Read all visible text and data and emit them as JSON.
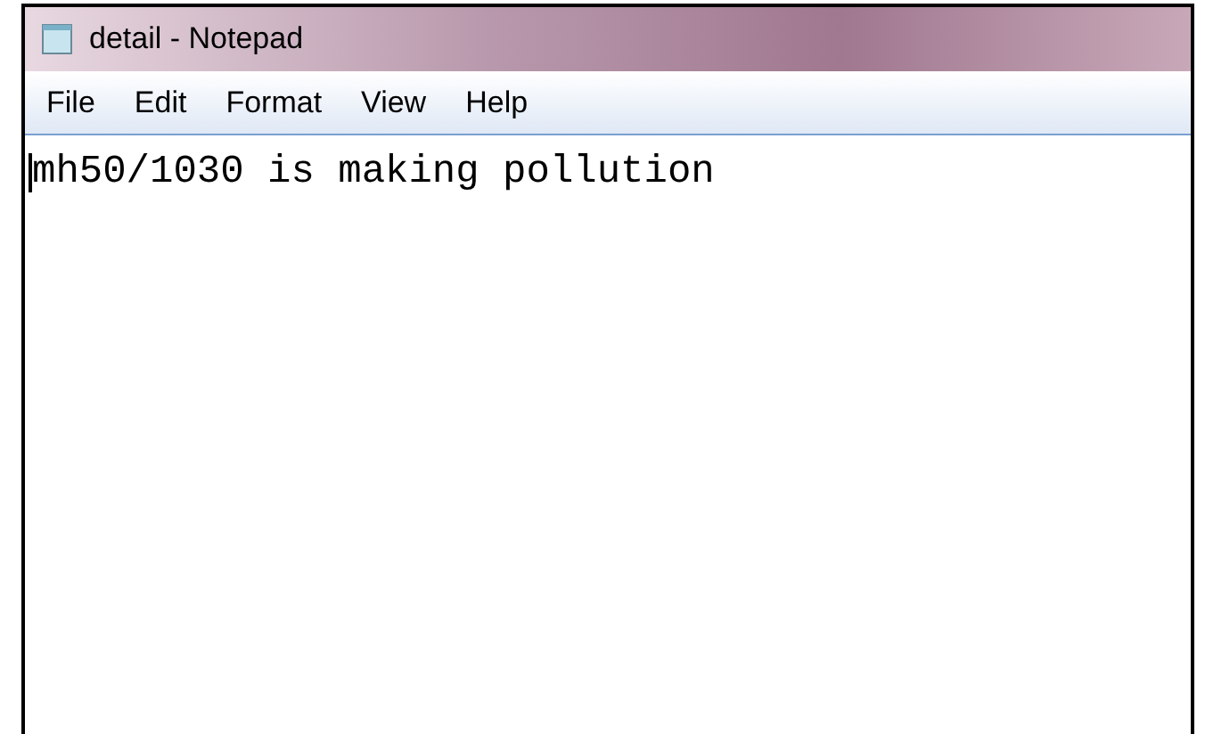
{
  "window": {
    "title": "detail - Notepad"
  },
  "menu": [
    "File",
    "Edit",
    "Format",
    "View",
    "Help"
  ],
  "editor": {
    "value": "mh50/1030 is making pollution"
  }
}
